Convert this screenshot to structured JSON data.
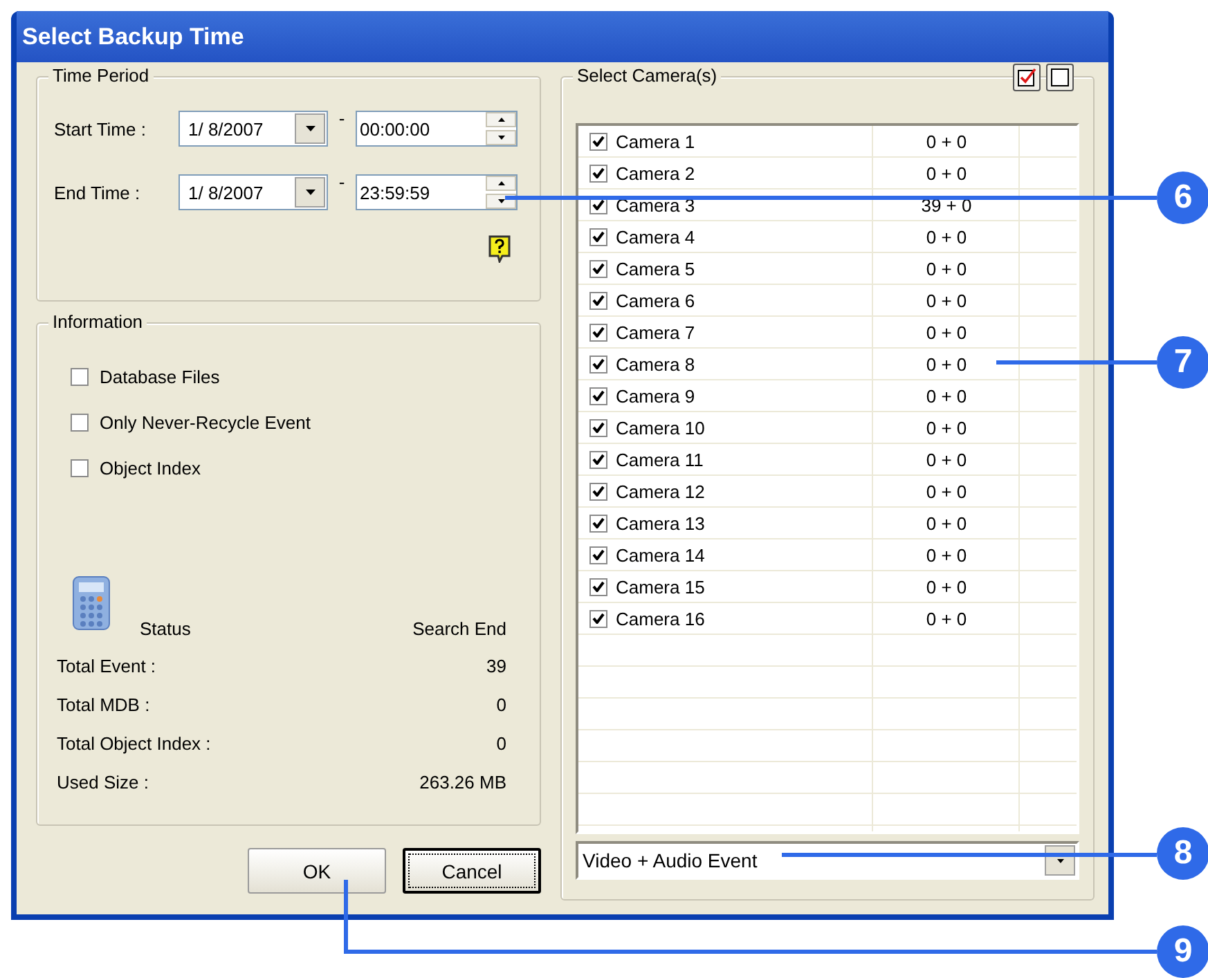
{
  "window": {
    "title": "Select Backup Time"
  },
  "time_period": {
    "title": "Time Period",
    "rows": [
      {
        "label": "Start Time :",
        "date": "1/  8/2007",
        "time": "00:00:00"
      },
      {
        "label": "End Time :",
        "date": "1/  8/2007",
        "time": "23:59:59"
      }
    ],
    "separator": "-"
  },
  "information": {
    "title": "Information",
    "options": [
      {
        "label": "Database Files",
        "checked": false
      },
      {
        "label": "Only Never-Recycle Event",
        "checked": false
      },
      {
        "label": "Object Index",
        "checked": false
      }
    ],
    "status": {
      "label": "Status",
      "value": "Search End"
    },
    "stats": [
      {
        "label": "Total Event :",
        "value": "39"
      },
      {
        "label": "Total MDB :",
        "value": "0"
      },
      {
        "label": "Total Object Index :",
        "value": "0"
      },
      {
        "label": "Used Size :",
        "value": "263.26 MB"
      }
    ]
  },
  "buttons": [
    {
      "label": "OK",
      "focused": false
    },
    {
      "label": "Cancel",
      "focused": true
    }
  ],
  "cameras": {
    "title": "Select Camera(s)",
    "rows": [
      {
        "name": "Camera 1",
        "checked": true,
        "count": "0 + 0"
      },
      {
        "name": "Camera 2",
        "checked": true,
        "count": "0 + 0"
      },
      {
        "name": "Camera 3",
        "checked": true,
        "count": "39 + 0"
      },
      {
        "name": "Camera 4",
        "checked": true,
        "count": "0 + 0"
      },
      {
        "name": "Camera 5",
        "checked": true,
        "count": "0 + 0"
      },
      {
        "name": "Camera 6",
        "checked": true,
        "count": "0 + 0"
      },
      {
        "name": "Camera 7",
        "checked": true,
        "count": "0 + 0"
      },
      {
        "name": "Camera 8",
        "checked": true,
        "count": "0 + 0"
      },
      {
        "name": "Camera 9",
        "checked": true,
        "count": "0 + 0"
      },
      {
        "name": "Camera 10",
        "checked": true,
        "count": "0 + 0"
      },
      {
        "name": "Camera 11",
        "checked": true,
        "count": "0 + 0"
      },
      {
        "name": "Camera 12",
        "checked": true,
        "count": "0 + 0"
      },
      {
        "name": "Camera 13",
        "checked": true,
        "count": "0 + 0"
      },
      {
        "name": "Camera 14",
        "checked": true,
        "count": "0 + 0"
      },
      {
        "name": "Camera 15",
        "checked": true,
        "count": "0 + 0"
      },
      {
        "name": "Camera 16",
        "checked": true,
        "count": "0 + 0"
      }
    ],
    "event_type": "Video + Audio Event"
  },
  "callouts": [
    "6",
    "7",
    "8",
    "9"
  ]
}
